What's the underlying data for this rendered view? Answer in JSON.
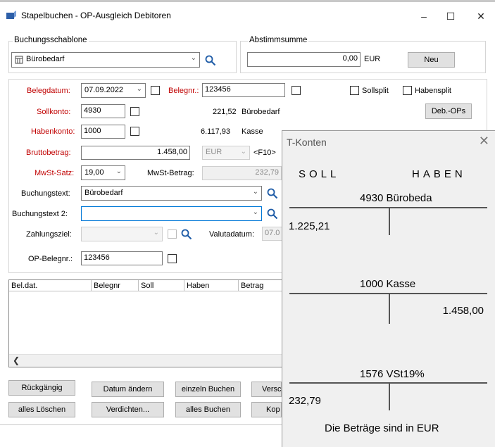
{
  "window": {
    "title": "Stapelbuchen - OP-Ausgleich Debitoren",
    "minimize": "–",
    "maximize": "☐",
    "close": "✕"
  },
  "template": {
    "group_label": "Buchungsschablone",
    "value": "Bürobedarf"
  },
  "abstimm": {
    "group_label": "Abstimmsumme",
    "value": "0,00",
    "currency": "EUR",
    "new_button": "Neu"
  },
  "form": {
    "belegdatum_label": "Belegdatum:",
    "belegdatum_value": "07.09.2022",
    "belegnr_label": "Belegnr.:",
    "belegnr_value": "123456",
    "sollsplit_label": "Sollsplit",
    "habensplit_label": "Habensplit",
    "sollkonto_label": "Sollkonto:",
    "sollkonto_value": "4930",
    "sollkonto_balance": "221,52",
    "sollkonto_name": "Bürobedarf",
    "deb_ops_button": "Deb.-OPs",
    "habenkonto_label": "Habenkonto:",
    "habenkonto_value": "1000",
    "habenkonto_balance": "6.117,93",
    "habenkonto_name": "Kasse",
    "brutto_label": "Bruttobetrag:",
    "brutto_value": "1.458,00",
    "currency_value": "EUR",
    "f10_hint": "<F10>",
    "mwst_label": "MwSt-Satz:",
    "mwst_value": "19,00",
    "mwst_betrag_label": "MwSt-Betrag:",
    "mwst_betrag_value": "232,79",
    "buchungstext_label": "Buchungstext:",
    "buchungstext_value": "Bürobedarf",
    "buchungstext2_label": "Buchungstext 2:",
    "buchungstext2_value": "",
    "zahlungsziel_label": "Zahlungsziel:",
    "valutadatum_label": "Valutadatum:",
    "valutadatum_value": "07.0",
    "opbelegnr_label": "OP-Belegnr.:",
    "opbelegnr_value": "123456"
  },
  "table": {
    "columns": [
      "Bel.dat.",
      "Belegnr",
      "Soll",
      "Haben",
      "Betrag"
    ]
  },
  "buttons": {
    "rueckgaengig": "Rückgängig",
    "datum_aendern": "Datum ändern",
    "einzeln_buchen": "einzeln Buchen",
    "versc": "Versc",
    "alles_loeschen": "alles Löschen",
    "verdichten": "Verdichten...",
    "alles_buchen": "alles Buchen",
    "kop": "Kop"
  },
  "tkonten": {
    "title": "T-Konten",
    "close": "✕",
    "soll_header": "SOLL",
    "haben_header": "HABEN",
    "accounts": [
      {
        "title": "4930  Bürobeda",
        "soll": "1.225,21",
        "haben": ""
      },
      {
        "title": "1000  Kasse",
        "soll": "",
        "haben": "1.458,00"
      },
      {
        "title": "1576  VSt19%",
        "soll": "232,79",
        "haben": ""
      }
    ],
    "footer": "Die Beträge sind in EUR"
  }
}
